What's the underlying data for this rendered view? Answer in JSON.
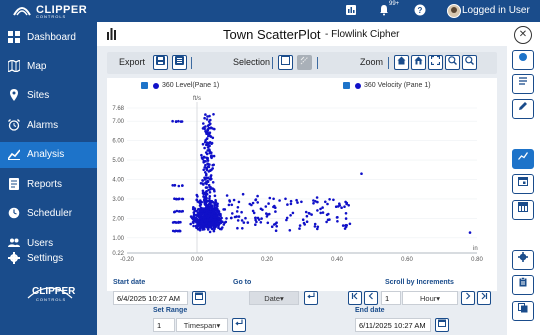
{
  "app": {
    "brand": "CLIPPER",
    "brand_sub": "CONTROLS",
    "notification_badge": "99+",
    "user_label": "Logged in User"
  },
  "sidebar": {
    "items": [
      {
        "label": "Dashboard",
        "icon": "dashboard-icon"
      },
      {
        "label": "Map",
        "icon": "map-icon"
      },
      {
        "label": "Sites",
        "icon": "location-pin-icon"
      },
      {
        "label": "Alarms",
        "icon": "alarm-clock-icon"
      },
      {
        "label": "Analysis",
        "icon": "analysis-chart-icon",
        "active": true
      },
      {
        "label": "Reports",
        "icon": "report-icon"
      },
      {
        "label": "Scheduler",
        "icon": "clock-icon"
      },
      {
        "label": "Users",
        "icon": "users-icon"
      },
      {
        "label": "Settings",
        "icon": "gear-icon"
      }
    ]
  },
  "main": {
    "title": "Town ScatterPlot",
    "subtitle": "- Flowlink Cipher"
  },
  "toolbar": {
    "export_label": "Export",
    "selection_label": "Selection",
    "zoom_label": "Zoom"
  },
  "chart_data": {
    "type": "scatter",
    "legend": [
      "360 Level(Pane 1)",
      "360 Velocity (Pane 1)"
    ],
    "ylabel": "ft/s",
    "xlabel": "in",
    "y_ticks": [
      "7.68",
      "7.00",
      "6.00",
      "5.00",
      "4.00",
      "3.00",
      "2.00",
      "1.00",
      "0.22"
    ],
    "x_ticks": [
      "-0.20",
      "0.00",
      "0.20",
      "0.40",
      "0.60",
      "0.80"
    ],
    "xlim": [
      -0.2,
      0.8
    ],
    "ylim": [
      0.22,
      7.68
    ],
    "color": "#1010c8"
  },
  "controls": {
    "start_date_label": "Start date",
    "start_date_value": "6/4/2025 10:27 AM",
    "goto_label": "Go to",
    "goto_select": "Date",
    "scroll_label": "Scroll by Increments",
    "scroll_value": "1",
    "scroll_unit": "Hour",
    "set_range_label": "Set Range",
    "range_value": "1",
    "range_unit": "Timespan",
    "end_date_label": "End date",
    "end_date_value": "6/11/2025 10:27 AM"
  }
}
